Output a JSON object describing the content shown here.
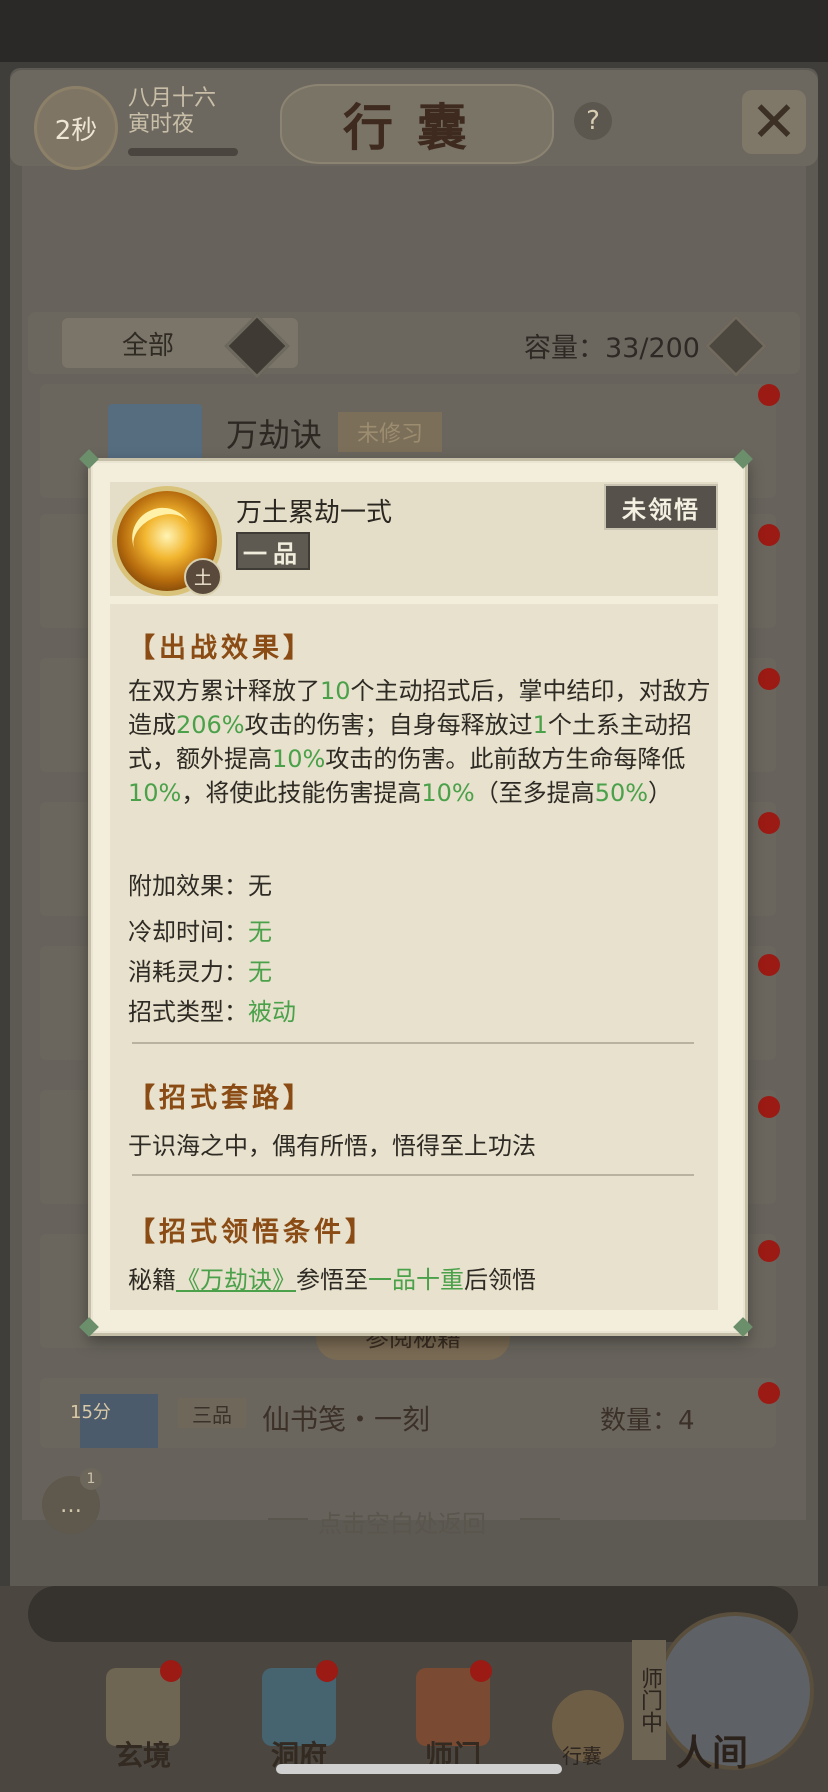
{
  "header": {
    "timer": "2秒",
    "date_line1": "八月十六",
    "date_line2": "寅时夜",
    "title": "行囊",
    "help": "?"
  },
  "filter": {
    "label": "全部",
    "capacity": "容量：33/200"
  },
  "bag": {
    "visible_item_name": "万劫诀",
    "visible_item_tag": "未修习",
    "partial_button": "参阅秘籍",
    "bottom_item": {
      "tag": "15分",
      "grade": "三品",
      "name": "仙书笺・一刻",
      "qty": "数量：4"
    }
  },
  "chat": {
    "badge": "1"
  },
  "hint": "点击空白处返回",
  "nav": {
    "items": [
      "玄境",
      "洞府",
      "师门"
    ],
    "bag_label": "行囊",
    "sect_tag": "师门中",
    "world_label": "人间"
  },
  "popup": {
    "skill_name": "万土累劫一式",
    "grade": "一品",
    "status": "未领悟",
    "element": "土",
    "effect_title": "【出战效果】",
    "effect": [
      {
        "t": "在双方累计释放了"
      },
      {
        "t": "10",
        "g": true
      },
      {
        "t": "个主动招式后，掌中结印，对敌方造成"
      },
      {
        "t": "206%",
        "g": true
      },
      {
        "t": "攻击的伤害；自身每释放过"
      },
      {
        "t": "1",
        "g": true
      },
      {
        "t": "个土系主动招式，额外提高"
      },
      {
        "t": "10%",
        "g": true
      },
      {
        "t": "攻击的伤害。此前敌方生命每降低"
      },
      {
        "t": "10%",
        "g": true
      },
      {
        "t": "，将使此技能伤害提高"
      },
      {
        "t": "10%",
        "g": true
      },
      {
        "t": "（至多提高"
      },
      {
        "t": "50%",
        "g": true
      },
      {
        "t": "）"
      }
    ],
    "extra_label": "附加效果：",
    "extra_value": "无",
    "cooldown_label": "冷却时间：",
    "cooldown_value": "无",
    "cost_label": "消耗灵力：",
    "cost_value": "无",
    "type_label": "招式类型：",
    "type_value": "被动",
    "route_title": "【招式套路】",
    "route_text": "于识海之中，偶有所悟，悟得至上功法",
    "cond_title": "【招式领悟条件】",
    "cond_prefix": "秘籍",
    "cond_book": "《万劫诀》",
    "cond_mid": "参悟至",
    "cond_level": "一品十重",
    "cond_suffix": "后领悟"
  },
  "colors": {
    "highlight_green": "#4aa14a",
    "section_title": "#8a4b14",
    "notify_dot": "#9b1a14"
  }
}
